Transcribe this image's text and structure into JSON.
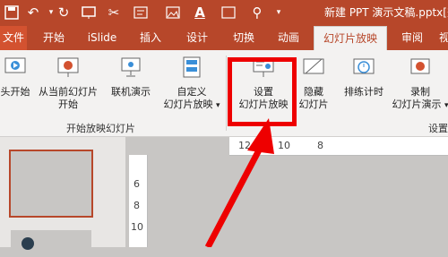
{
  "window": {
    "doc_title": "新建 PPT 演示文稿.pptx[兼"
  },
  "quick_access": {
    "icons": [
      "save-icon",
      "undo-icon",
      "redo-icon",
      "present-icon",
      "cut-icon",
      "textbox-icon",
      "picture-icon",
      "font-color-icon",
      "format-icon",
      "find-icon"
    ]
  },
  "tabs": [
    "文件",
    "开始",
    "iSlide",
    "插入",
    "设计",
    "切换",
    "动画",
    "幻灯片放映",
    "审阅",
    "视"
  ],
  "ribbon": {
    "from_start": "头开始",
    "from_current_1": "从当前幻灯片",
    "from_current_2": "开始",
    "online_present": "联机演示",
    "custom_1": "自定义",
    "custom_2": "幻灯片放映",
    "setup_1": "设置",
    "setup_2": "幻灯片放映",
    "hide_1": "隐藏",
    "hide_2": "幻灯片",
    "rehearse": "排练计时",
    "record_1": "录制",
    "record_2": "幻灯片演示",
    "group_start": "开始放映幻灯片",
    "group_setup": "设置"
  },
  "rulers": {
    "h": [
      "12",
      "10",
      "8"
    ],
    "v": [
      "6",
      "8",
      "10"
    ]
  },
  "colors": {
    "accent": "#b7472a",
    "highlight": "#e00000"
  }
}
